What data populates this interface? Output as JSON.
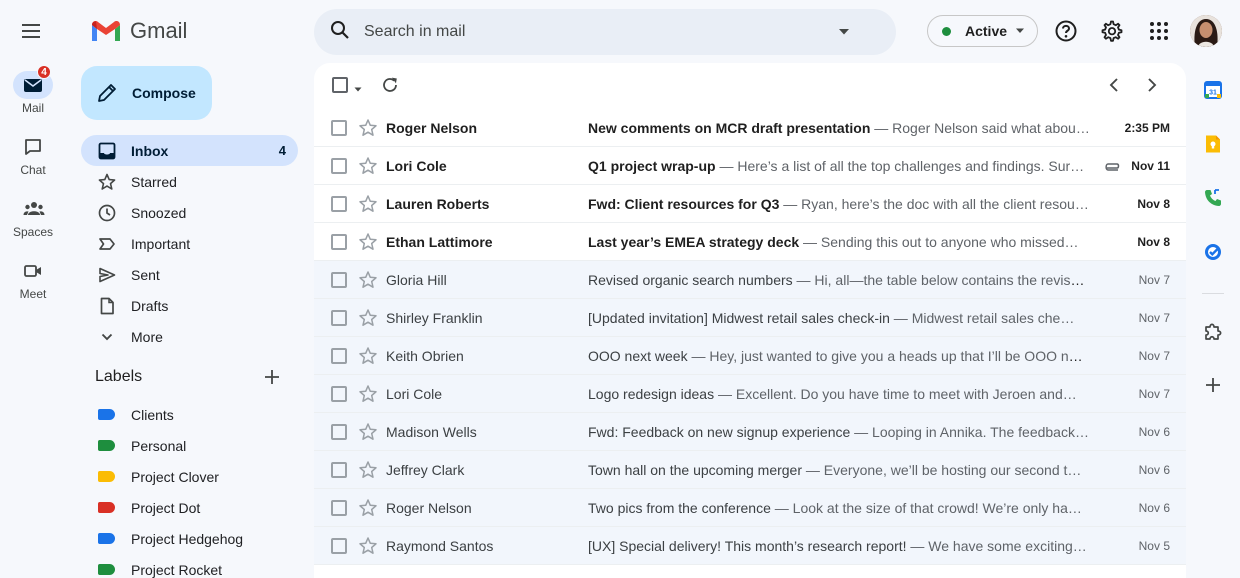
{
  "app": {
    "name": "Gmail"
  },
  "rail": {
    "items": [
      {
        "label": "Mail",
        "badge": "4",
        "icon": "mail-icon"
      },
      {
        "label": "Chat",
        "icon": "chat-icon"
      },
      {
        "label": "Spaces",
        "icon": "spaces-icon"
      },
      {
        "label": "Meet",
        "icon": "meet-icon"
      }
    ]
  },
  "compose": {
    "label": "Compose"
  },
  "nav": {
    "items": [
      {
        "label": "Inbox",
        "count": "4",
        "icon": "inbox-icon"
      },
      {
        "label": "Starred",
        "icon": "star-icon"
      },
      {
        "label": "Snoozed",
        "icon": "clock-icon"
      },
      {
        "label": "Important",
        "icon": "important-icon"
      },
      {
        "label": "Sent",
        "icon": "send-icon"
      },
      {
        "label": "Drafts",
        "icon": "draft-icon"
      },
      {
        "label": "More",
        "icon": "chevron-down-icon"
      }
    ]
  },
  "labels": {
    "title": "Labels",
    "items": [
      {
        "label": "Clients",
        "color": "#1a73e8"
      },
      {
        "label": "Personal",
        "color": "#1e8e3e"
      },
      {
        "label": "Project Clover",
        "color": "#fbbc04"
      },
      {
        "label": "Project Dot",
        "color": "#d93025"
      },
      {
        "label": "Project Hedgehog",
        "color": "#1a73e8"
      },
      {
        "label": "Project Rocket",
        "color": "#1e8e3e"
      }
    ]
  },
  "search": {
    "placeholder": "Search in mail"
  },
  "status": {
    "label": "Active",
    "color": "#1e8e3e"
  },
  "emails": [
    {
      "sender": "Roger Nelson",
      "subject": "New comments on MCR draft presentation",
      "snippet": " — Roger Nelson said what abou…",
      "date": "2:35 PM",
      "unread": true
    },
    {
      "sender": "Lori Cole",
      "subject": "Q1 project wrap-up",
      "snippet": " — Here’s a list of all the top challenges and findings. Sur…",
      "date": "Nov 11",
      "unread": true,
      "attachment": true
    },
    {
      "sender": "Lauren Roberts",
      "subject": "Fwd: Client resources for Q3",
      "snippet": " — Ryan, here’s the doc with all the client resou…",
      "date": "Nov 8",
      "unread": true
    },
    {
      "sender": "Ethan Lattimore",
      "subject": "Last year’s EMEA strategy deck",
      "snippet": " — Sending this out to anyone who missed…",
      "date": "Nov 8",
      "unread": true
    },
    {
      "sender": "Gloria Hill",
      "subject": "Revised organic search numbers",
      "snippet": " — Hi, all—the table below contains the revise…",
      "date": "Nov 7",
      "unread": false
    },
    {
      "sender": "Shirley Franklin",
      "subject": "[Updated invitation] Midwest retail sales check-in",
      "snippet": " — Midwest retail sales che…",
      "date": "Nov 7",
      "unread": false
    },
    {
      "sender": "Keith Obrien",
      "subject": "OOO next week",
      "snippet": " — Hey, just wanted to give you a heads up that I’ll be OOO ne…",
      "date": "Nov 7",
      "unread": false
    },
    {
      "sender": "Lori Cole",
      "subject": "Logo redesign ideas",
      "snippet": " — Excellent. Do you have time to meet with Jeroen and…",
      "date": "Nov 7",
      "unread": false
    },
    {
      "sender": "Madison Wells",
      "subject": "Fwd: Feedback on new signup experience",
      "snippet": " — Looping in Annika. The feedback…",
      "date": "Nov 6",
      "unread": false
    },
    {
      "sender": "Jeffrey Clark",
      "subject": "Town hall on the upcoming merger",
      "snippet": " — Everyone, we’ll be hosting our second t…",
      "date": "Nov 6",
      "unread": false
    },
    {
      "sender": "Roger Nelson",
      "subject": "Two pics from the conference",
      "snippet": " — Look at the size of that crowd! We’re only ha…",
      "date": "Nov 6",
      "unread": false
    },
    {
      "sender": "Raymond Santos",
      "subject": "[UX] Special delivery! This month’s research report!",
      "snippet": " — We have some exciting…",
      "date": "Nov 5",
      "unread": false
    }
  ]
}
